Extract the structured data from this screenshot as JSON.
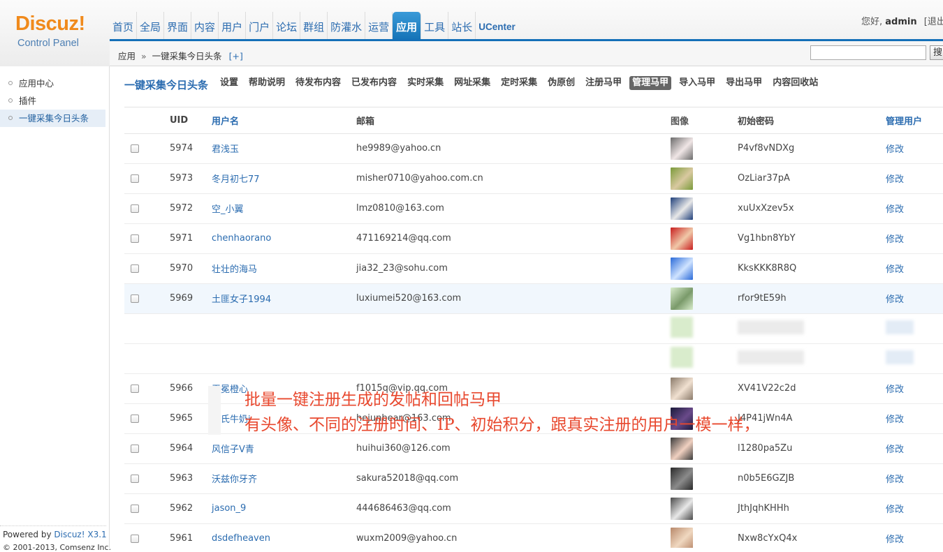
{
  "logo": {
    "brand": "Discuz!",
    "subtitle": "Control Panel"
  },
  "topnav": [
    "首页",
    "全局",
    "界面",
    "内容",
    "用户",
    "门户",
    "论坛",
    "群组",
    "防灌水",
    "运营",
    "应用",
    "工具",
    "站长",
    "UCenter"
  ],
  "topnav_active": "应用",
  "userinfo": {
    "greeting": "您好,",
    "username": "admin",
    "logout": "[退出]"
  },
  "breadcrumb": {
    "section": "应用",
    "separator": "»",
    "page": "一键采集今日头条",
    "add": "[+]"
  },
  "search": {
    "value": "",
    "button": "搜"
  },
  "sidebar": {
    "items": [
      "应用中心",
      "插件",
      "一键采集今日头条"
    ],
    "active": "一键采集今日头条",
    "powered_by": "Powered by",
    "version": "Discuz! X3.1",
    "copyright": "© 2001-2013, Comsenz Inc."
  },
  "plugin": {
    "title": "一键采集今日头条",
    "tabs": [
      "设置",
      "帮助说明",
      "待发布内容",
      "已发布内容",
      "实时采集",
      "网址采集",
      "定时采集",
      "伪原创",
      "注册马甲",
      "管理马甲",
      "导入马甲",
      "导出马甲",
      "内容回收站"
    ],
    "active_tab": "管理马甲"
  },
  "table": {
    "headers": {
      "uid": "UID",
      "username": "用户名",
      "email": "邮箱",
      "avatar": "图像",
      "password": "初始密码",
      "manage": "管理用户"
    },
    "edit_label": "修改",
    "rows": [
      {
        "uid": "5974",
        "name": "君浅玉",
        "email": "he9989@yahoo.cn",
        "pwd": "P4vf8vNDXg",
        "avatar": [
          "#6b6b6b",
          "#f0e6e6"
        ]
      },
      {
        "uid": "5973",
        "name": "冬月初七77",
        "email": "misher0710@yahoo.com.cn",
        "pwd": "OzLiar37pA",
        "avatar": [
          "#7a9a3a",
          "#d9c9a0"
        ]
      },
      {
        "uid": "5972",
        "name": "空_小翼",
        "email": "lmz0810@163.com",
        "pwd": "xuUxXzev5x",
        "avatar": [
          "#1f3f7a",
          "#e8e8e8"
        ]
      },
      {
        "uid": "5971",
        "name": "chenhaorano",
        "email": "471169214@qq.com",
        "pwd": "Vg1hbn8YbY",
        "avatar": [
          "#c81e1e",
          "#f0c8a8"
        ]
      },
      {
        "uid": "5970",
        "name": "壮壮的海马",
        "email": "jia32_23@sohu.com",
        "pwd": "KksKKK8R8Q",
        "avatar": [
          "#2a6ad8",
          "#cfe3ff"
        ]
      },
      {
        "uid": "5969",
        "name": "土匪女子1994",
        "email": "luxiumei520@163.com",
        "pwd": "rfor9tE59h",
        "avatar": [
          "#d8eccc",
          "#7a9a6a"
        ]
      },
      {
        "uid": "5966",
        "name": "无冕橙心",
        "email": "f1015q@vip.qq.com",
        "pwd": "XV41V22c2d",
        "avatar": [
          "#8a7a6a",
          "#f0e0d0"
        ]
      },
      {
        "uid": "5965",
        "name": "巴氏牛奶i",
        "email": "hejunbear@163.com",
        "pwd": "J4P41jWn4A",
        "avatar": [
          "#1a1a3a",
          "#6a4a8a"
        ]
      },
      {
        "uid": "5964",
        "name": "风信子V青",
        "email": "huihui360@126.com",
        "pwd": "l1280pa5Zu",
        "avatar": [
          "#3a3a3a",
          "#f0d0c0"
        ]
      },
      {
        "uid": "5963",
        "name": "沃兹你牙齐",
        "email": "sakura52018@qq.com",
        "pwd": "n0b5E6GZJB",
        "avatar": [
          "#2a2a2a",
          "#8a8a8a"
        ]
      },
      {
        "uid": "5962",
        "name": "jason_9",
        "email": "444686463@qq.com",
        "pwd": "JthJqhKHHh",
        "avatar": [
          "#4a4a4a",
          "#e8e8e8"
        ]
      },
      {
        "uid": "5961",
        "name": "dsdefheaven",
        "email": "wuxm2009@yahoo.cn",
        "pwd": "Nxw8cYxQ4x",
        "avatar": [
          "#b8886a",
          "#f0d8c0"
        ]
      }
    ]
  },
  "overlay": {
    "line1": "批量一键注册生成的发帖和回帖马甲",
    "line2": "有头像、不同的注册时间、IP、初始积分，跟真实注册的用户一模一样，"
  }
}
